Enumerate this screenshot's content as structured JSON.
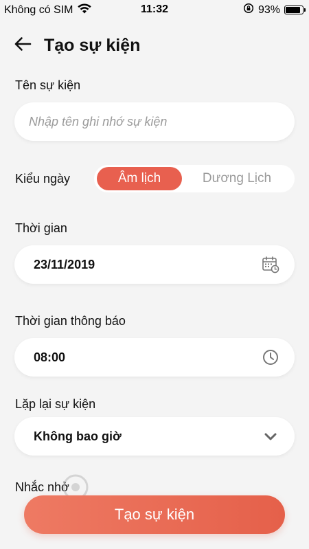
{
  "status_bar": {
    "carrier": "Không có SIM",
    "time": "11:32",
    "battery": "93%",
    "battery_level": 0.93
  },
  "header": {
    "title": "Tạo sự kiện"
  },
  "event_name": {
    "label": "Tên sự kiện",
    "placeholder": "Nhập tên ghi nhớ sự kiện",
    "value": ""
  },
  "date_type": {
    "label": "Kiểu ngày",
    "options": [
      "Âm lịch",
      "Dương Lịch"
    ],
    "selected": "Âm lịch"
  },
  "time": {
    "label": "Thời gian",
    "value": "23/11/2019",
    "icon": "calendar-icon"
  },
  "notify_time": {
    "label": "Thời gian thông báo",
    "value": "08:00",
    "icon": "clock-icon"
  },
  "repeat": {
    "label": "Lặp lại sự kiện",
    "value": "Không bao giờ",
    "icon": "chevron-down-icon"
  },
  "reminder": {
    "label": "Nhắc nhở"
  },
  "submit": {
    "label": "Tạo sự kiện"
  },
  "colors": {
    "accent": "#e8604f",
    "background": "#f4f4f4",
    "field": "#ffffff"
  }
}
